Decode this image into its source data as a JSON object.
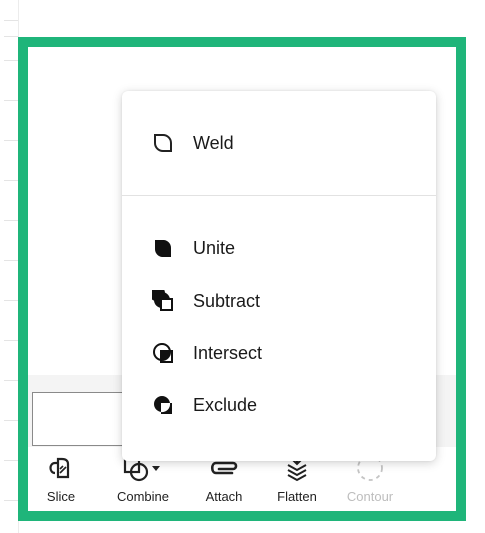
{
  "menu": {
    "items": [
      {
        "label": "Weld",
        "icon": "weld-icon"
      },
      {
        "label": "Unite",
        "icon": "unite-icon"
      },
      {
        "label": "Subtract",
        "icon": "subtract-icon"
      },
      {
        "label": "Intersect",
        "icon": "intersect-icon"
      },
      {
        "label": "Exclude",
        "icon": "exclude-icon"
      }
    ]
  },
  "toolbar": {
    "items": [
      {
        "label": "Slice",
        "icon": "slice-icon",
        "enabled": true
      },
      {
        "label": "Combine",
        "icon": "combine-icon",
        "enabled": true
      },
      {
        "label": "Attach",
        "icon": "attach-icon",
        "enabled": true
      },
      {
        "label": "Flatten",
        "icon": "flatten-icon",
        "enabled": true
      },
      {
        "label": "Contour",
        "icon": "contour-icon",
        "enabled": false
      }
    ]
  },
  "colors": {
    "highlight_frame": "#1fb57a",
    "text": "#1a1a1a",
    "disabled_text": "#bdbdbd"
  }
}
